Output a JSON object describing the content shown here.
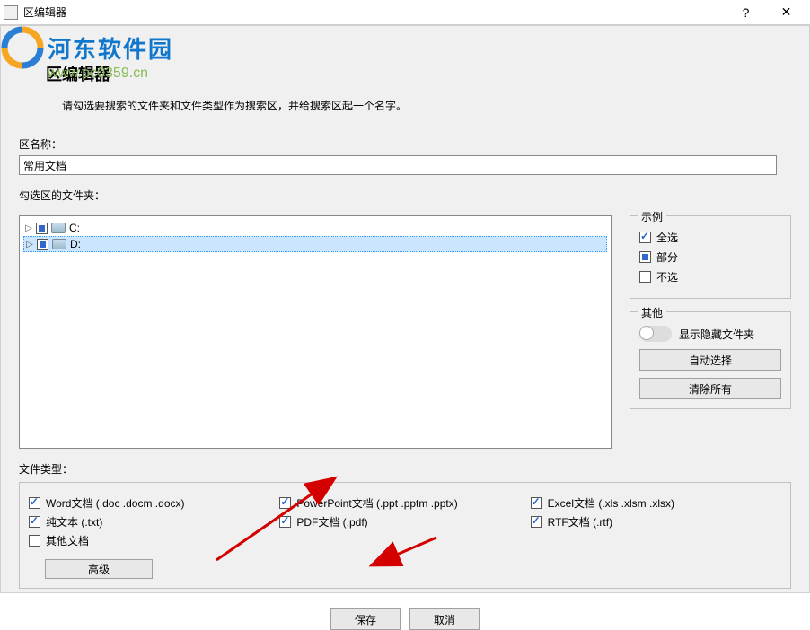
{
  "titlebar": {
    "icon": "app-icon",
    "title": "区编辑器",
    "help": "?",
    "close": "✕"
  },
  "watermark": {
    "brand": "河东软件园",
    "url": "www.pc0359.cn"
  },
  "main": {
    "title": "区编辑器",
    "desc": "请勾选要搜索的文件夹和文件类型作为搜索区，并给搜索区起一个名字。"
  },
  "zone_name": {
    "label": "区名称：",
    "value": "常用文档"
  },
  "folders": {
    "label": "勾选区的文件夹：",
    "items": [
      {
        "label": "C:",
        "state": "partial",
        "selected": false
      },
      {
        "label": "D:",
        "state": "partial",
        "selected": true
      }
    ]
  },
  "example": {
    "title": "示例",
    "all": "全选",
    "partial": "部分",
    "none": "不选"
  },
  "other": {
    "title": "其他",
    "show_hidden": "显示隐藏文件夹",
    "auto_select": "自动选择",
    "clear_all": "清除所有"
  },
  "filetypes": {
    "label": "文件类型：",
    "items": {
      "word": "Word文档 (.doc .docm .docx)",
      "ppt": "PowerPoint文档 (.ppt .pptm .pptx)",
      "excel": "Excel文档 (.xls .xlsm .xlsx)",
      "txt": "纯文本 (.txt)",
      "pdf": "PDF文档 (.pdf)",
      "rtf": "RTF文档 (.rtf)",
      "other": "其他文档"
    },
    "advanced": "高级"
  },
  "buttons": {
    "save": "保存",
    "cancel": "取消"
  }
}
